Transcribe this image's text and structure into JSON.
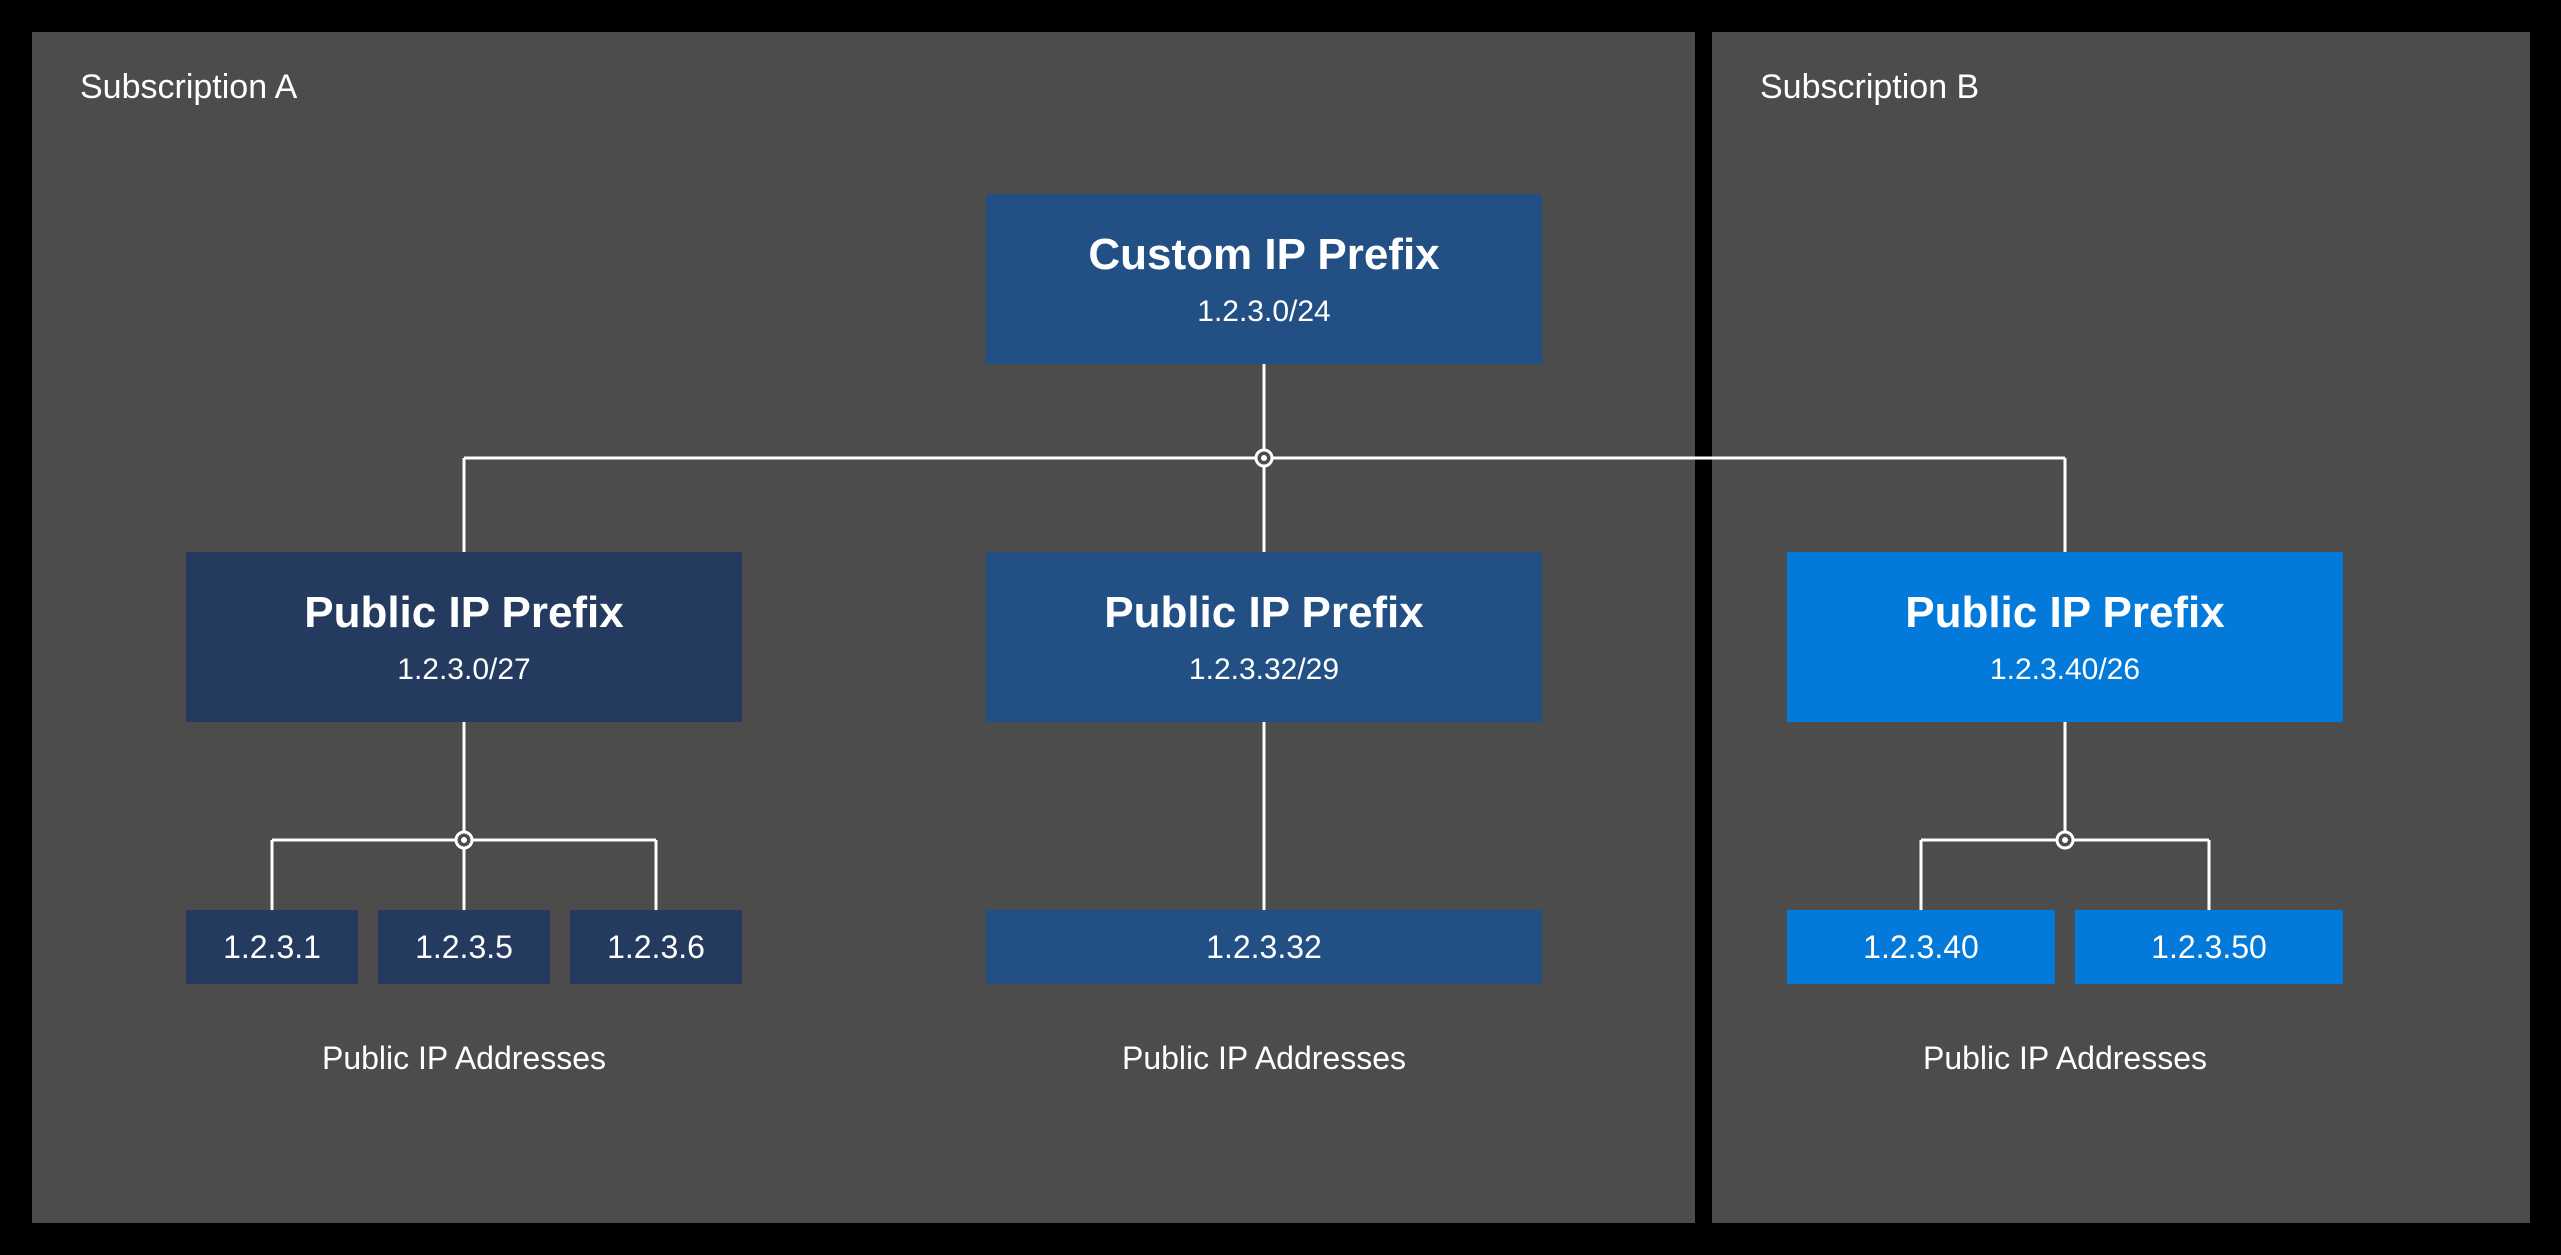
{
  "panels": {
    "a": {
      "label": "Subscription A"
    },
    "b": {
      "label": "Subscription B"
    }
  },
  "root": {
    "title": "Custom IP Prefix",
    "cidr": "1.2.3.0/24"
  },
  "prefixes": [
    {
      "title": "Public IP Prefix",
      "cidr": "1.2.3.0/27"
    },
    {
      "title": "Public IP Prefix",
      "cidr": "1.2.3.32/29"
    },
    {
      "title": "Public IP Prefix",
      "cidr": "1.2.3.40/26"
    }
  ],
  "leaves": {
    "group1": [
      "1.2.3.1",
      "1.2.3.5",
      "1.2.3.6"
    ],
    "group2": [
      "1.2.3.32"
    ],
    "group3": [
      "1.2.3.40",
      "1.2.3.50"
    ]
  },
  "captions": {
    "addresses": "Public IP Addresses"
  }
}
